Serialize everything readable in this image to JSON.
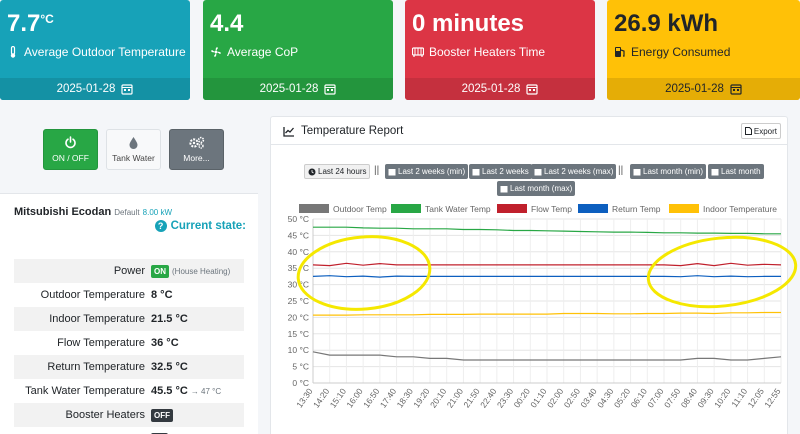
{
  "kpis": [
    {
      "value": "7.7",
      "unit": "°C",
      "label": "Average Outdoor Temperature",
      "date": "2025-01-28",
      "icon": "thermometer-icon"
    },
    {
      "value": "4.4",
      "label": "Average CoP",
      "date": "2025-01-28",
      "icon": "fan-icon"
    },
    {
      "value": "0 minutes",
      "label": "Booster Heaters Time",
      "date": "2025-01-28",
      "icon": "heater-icon"
    },
    {
      "value": "26.9 kWh",
      "label": "Energy Consumed",
      "date": "2025-01-28",
      "icon": "fuel-icon"
    }
  ],
  "controls": {
    "on_off": "ON / OFF",
    "tank_water": "Tank Water",
    "more": "More..."
  },
  "device": {
    "name": "Mitsubishi Ecodan",
    "subtitle": "Default",
    "power_kw": "8.00 kW",
    "current_state": "Current state:",
    "rows": [
      {
        "key": "Power",
        "badge": "ON",
        "note": "(House Heating)"
      },
      {
        "key": "Outdoor Temperature",
        "value": "8 °C"
      },
      {
        "key": "Indoor Temperature",
        "value": "21.5 °C"
      },
      {
        "key": "Flow Temperature",
        "value": "36 °C"
      },
      {
        "key": "Return Temperature",
        "value": "32.5 °C"
      },
      {
        "key": "Tank Water Temperature",
        "value": "45.5 °C",
        "note": "→ 47 °C"
      },
      {
        "key": "Booster Heaters",
        "badge": "OFF"
      },
      {
        "key": "Defrost"
      }
    ]
  },
  "report": {
    "title": "Temperature Report",
    "export": "Export",
    "ranges": [
      "Last 24 hours",
      "Last 2 weeks (min)",
      "Last 2 weeks",
      "Last 2 weeks (max)",
      "Last month (min)",
      "Last month",
      "Last month (max)"
    ],
    "separator": "||"
  },
  "colors": {
    "outdoor": "#777777",
    "tank": "#28a745",
    "flow": "#c0202c",
    "return": "#0d5fbf",
    "indoor": "#ffc107",
    "annotation": "#f5e800"
  },
  "chart_data": {
    "type": "line",
    "title": "",
    "ylim": [
      0,
      50
    ],
    "y_ticks": [
      "0 °C",
      "5 °C",
      "10 °C",
      "15 °C",
      "20 °C",
      "25 °C",
      "30 °C",
      "35 °C",
      "40 °C",
      "45 °C",
      "50 °C"
    ],
    "x": [
      "13:30",
      "14:20",
      "15:10",
      "16:00",
      "16:50",
      "17:40",
      "18:30",
      "19:20",
      "20:10",
      "21:00",
      "21:50",
      "22:40",
      "23:30",
      "00:20",
      "01:10",
      "02:00",
      "02:50",
      "03:40",
      "04:30",
      "05:20",
      "06:10",
      "07:00",
      "07:50",
      "08:40",
      "09:30",
      "10:20",
      "11:10",
      "12:05",
      "12:55"
    ],
    "series": [
      {
        "name": "Outdoor Temp",
        "values": [
          9.5,
          8.5,
          8.5,
          8.5,
          8.5,
          8,
          8,
          7.5,
          7.5,
          7,
          7,
          7,
          7,
          7,
          7,
          7,
          7,
          7,
          7,
          7,
          7,
          7,
          7,
          7.5,
          7.5,
          7,
          7,
          7.5,
          8
        ]
      },
      {
        "name": "Tank Water Temp",
        "values": [
          47.5,
          47.5,
          47.5,
          47.3,
          47.2,
          47.2,
          47,
          47,
          47,
          46.8,
          46.8,
          46.7,
          46.5,
          46.5,
          46.4,
          46.3,
          46.2,
          46.1,
          46,
          46,
          45.9,
          45.8,
          45.8,
          45.7,
          45.7,
          45.6,
          45.6,
          45.5,
          45.5
        ]
      },
      {
        "name": "Flow Temp",
        "values": [
          36,
          35.8,
          36.5,
          35.9,
          36.4,
          36,
          36,
          36,
          36,
          36,
          36,
          36,
          36,
          36,
          36,
          36,
          36,
          36,
          36,
          36,
          36,
          36,
          35.8,
          36.4,
          35.8,
          36.5,
          35.9,
          36.2,
          36
        ]
      },
      {
        "name": "Return Temp",
        "values": [
          32.5,
          32.7,
          32.4,
          32.6,
          32.3,
          32.6,
          32.5,
          32.5,
          32.5,
          32.5,
          32.5,
          32.5,
          32.5,
          32.5,
          32.5,
          32.5,
          32.5,
          32.5,
          32.5,
          32.5,
          32.5,
          32.5,
          32.4,
          32.7,
          32.4,
          32.6,
          32.4,
          32.5,
          32.5
        ]
      },
      {
        "name": "Indoor Temperature",
        "values": [
          20.7,
          20.7,
          20.7,
          20.8,
          20.8,
          20.8,
          20.8,
          20.9,
          20.9,
          20.9,
          21,
          21,
          21,
          21,
          21,
          21.2,
          21.2,
          21.2,
          21.1,
          21.1,
          21.2,
          21.2,
          21.3,
          21.3,
          21.2,
          21.4,
          21.4,
          21.5,
          21.5
        ]
      }
    ],
    "legend": "top",
    "grid": true
  }
}
